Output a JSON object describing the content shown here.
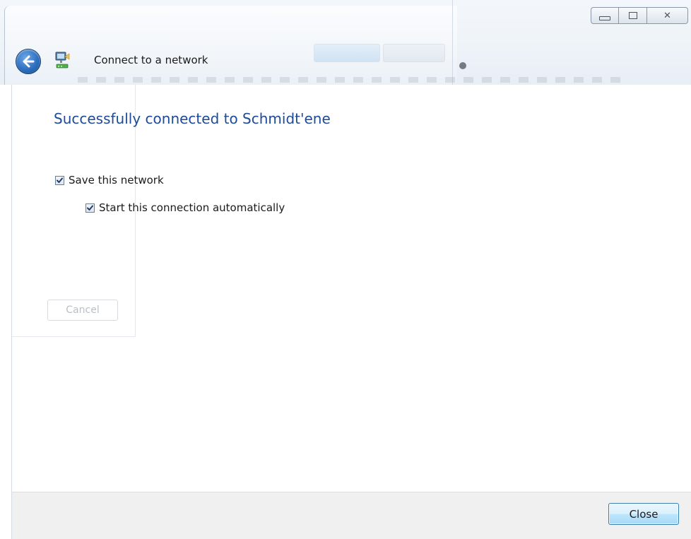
{
  "window": {
    "title": "Connect to a network"
  },
  "caption_buttons": {
    "minimize_icon": "minimize-icon",
    "maximize_icon": "maximize-icon",
    "close_icon": "close-icon",
    "close_glyph": "✕"
  },
  "content": {
    "heading": "Successfully connected to Schmidt'ene",
    "save_network_label": "Save this network",
    "save_network_checked": true,
    "auto_start_label": "Start this connection automatically",
    "auto_start_checked": true,
    "ghost_cancel_label": "Cancel"
  },
  "footer": {
    "close_label": "Close"
  },
  "colors": {
    "heading": "#1e4a9a",
    "accent": "#3c7fb1"
  }
}
